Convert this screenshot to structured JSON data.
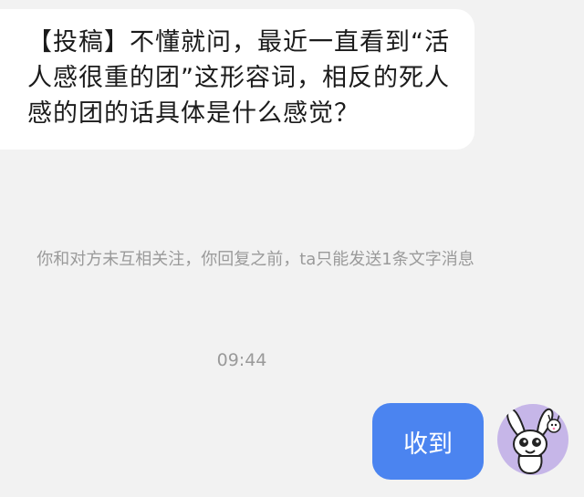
{
  "conversation": {
    "incoming_message": "【投稿】不懂就问，最近一直看到“活人感很重的团”这形容词，相反的死人感的团的话具体是什么感觉？",
    "system_notice": "你和对方未互相关注，你回复之前，ta只能发送1条文字消息",
    "timestamp": "09:44",
    "outgoing_message": "收到"
  },
  "avatar": {
    "icon": "cartoon-rabbit-avatar-icon",
    "background_color": "#c6b6e8"
  },
  "colors": {
    "page_background": "#f2f2f2",
    "incoming_bubble": "#ffffff",
    "outgoing_bubble": "#4b84f0",
    "muted_text": "#9a9a9a"
  }
}
